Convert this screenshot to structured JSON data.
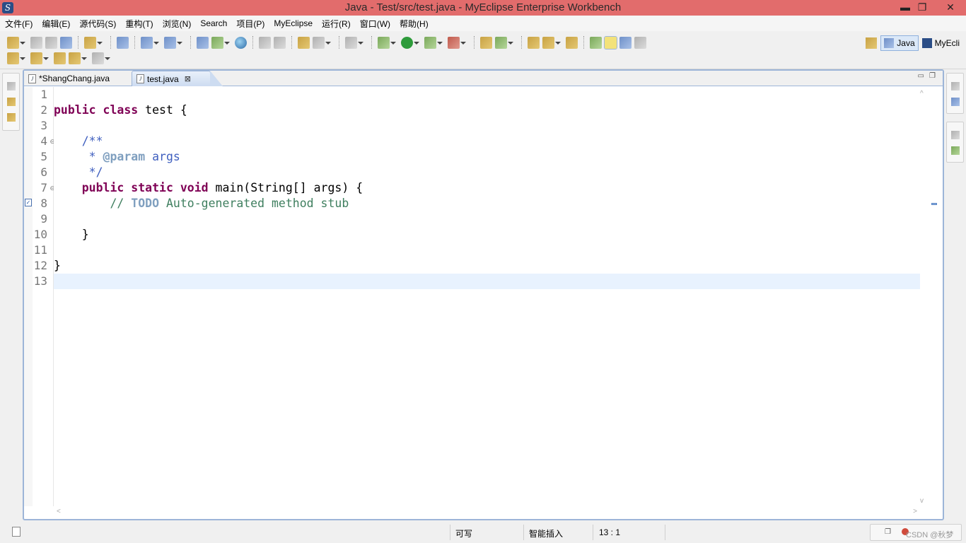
{
  "window": {
    "title": "Java  -  Test/src/test.java  -  MyEclipse Enterprise Workbench",
    "controls": {
      "minimize": "▬",
      "restore": "❐",
      "close": "✕"
    }
  },
  "menu": [
    "文件(F)",
    "编辑(E)",
    "源代码(S)",
    "重构(T)",
    "浏览(N)",
    "Search",
    "项目(P)",
    "MyEclipse",
    "运行(R)",
    "窗口(W)",
    "帮助(H)"
  ],
  "perspectives": {
    "java": "Java",
    "myeclipse": "MyEcli"
  },
  "editor": {
    "tabs": [
      {
        "label": "*ShangChang.java",
        "active": false
      },
      {
        "label": "test.java",
        "active": true
      }
    ],
    "close_glyph": "⊠",
    "lines": [
      {
        "no": "1",
        "fold": ""
      },
      {
        "no": "2",
        "fold": ""
      },
      {
        "no": "3",
        "fold": ""
      },
      {
        "no": "4",
        "fold": "⊖"
      },
      {
        "no": "5",
        "fold": ""
      },
      {
        "no": "6",
        "fold": ""
      },
      {
        "no": "7",
        "fold": "⊖"
      },
      {
        "no": "8",
        "fold": ""
      },
      {
        "no": "9",
        "fold": ""
      },
      {
        "no": "10",
        "fold": ""
      },
      {
        "no": "11",
        "fold": ""
      },
      {
        "no": "12",
        "fold": ""
      },
      {
        "no": "13",
        "fold": ""
      }
    ],
    "code": {
      "l2": {
        "kw1": "public",
        "kw2": "class",
        "rest": "test {"
      },
      "l4": {
        "text": "/**"
      },
      "l5": {
        "star": "* ",
        "tag": "@param",
        "rest": " args"
      },
      "l6": {
        "text": "*/"
      },
      "l7": {
        "kw1": "public",
        "kw2": "static",
        "kw3": "void",
        "rest": "main(String[] args) {"
      },
      "l8": {
        "slash": "// ",
        "todo": "TODO",
        "rest": " Auto-generated method stub"
      },
      "l10": {
        "text": "}"
      },
      "l12": {
        "text": "}"
      }
    },
    "current_line": 13
  },
  "status": {
    "writable": "可写",
    "insert_mode": "智能插入",
    "position": "13 : 1",
    "watermark": "CSDN @秋梦"
  },
  "colors": {
    "titlebar": "#e26c6c",
    "keyword": "#7f0055",
    "javadoc": "#3f5fbf",
    "comment": "#3f7f5f",
    "current_line": "#e8f2fe"
  }
}
